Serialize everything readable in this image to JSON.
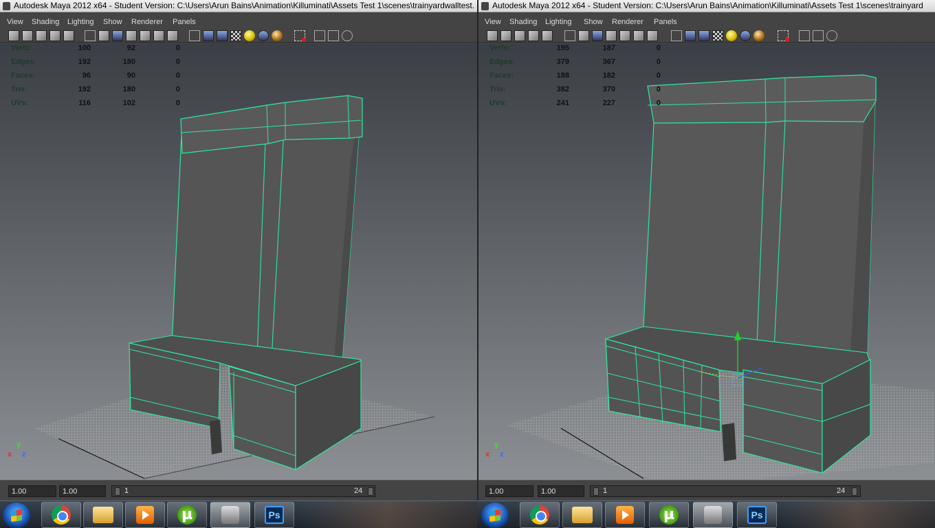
{
  "left": {
    "window_title": "Autodesk Maya 2012 x64 - Student Version: C:\\Users\\Arun Bains\\Animation\\Killuminati\\Assets Test 1\\scenes\\trainyardwalltest.",
    "menu": [
      "View",
      "Shading",
      "Lighting",
      "Show",
      "Renderer",
      "Panels"
    ],
    "stats": [
      {
        "label": "Verts:",
        "a": "100",
        "b": "92",
        "c": "0"
      },
      {
        "label": "Edges:",
        "a": "192",
        "b": "180",
        "c": "0"
      },
      {
        "label": "Faces:",
        "a": "96",
        "b": "90",
        "c": "0"
      },
      {
        "label": "Tris:",
        "a": "192",
        "b": "180",
        "c": "0"
      },
      {
        "label": "UVs:",
        "a": "116",
        "b": "102",
        "c": "0"
      }
    ],
    "axis": {
      "x": "x",
      "y": "y",
      "z": "z"
    },
    "time_start": "1.00",
    "time_end": "1.00",
    "frame_start": "1",
    "frame_end": "24"
  },
  "right": {
    "window_title": "Autodesk Maya 2012 x64 - Student Version: C:\\Users\\Arun Bains\\Animation\\Killuminati\\Assets Test 1\\scenes\\trainyard",
    "menu": [
      "View",
      "Shading",
      "Lighting",
      "Show",
      "Renderer",
      "Panels"
    ],
    "stats": [
      {
        "label": "Verts:",
        "a": "195",
        "b": "187",
        "c": "0"
      },
      {
        "label": "Edges:",
        "a": "379",
        "b": "367",
        "c": "0"
      },
      {
        "label": "Faces:",
        "a": "188",
        "b": "182",
        "c": "0"
      },
      {
        "label": "Tris:",
        "a": "382",
        "b": "370",
        "c": "0"
      },
      {
        "label": "UVs:",
        "a": "241",
        "b": "227",
        "c": "0"
      }
    ],
    "axis": {
      "x": "x",
      "y": "y",
      "z": "z"
    },
    "time_start": "1.00",
    "time_end": "1.00",
    "frame_start": "1",
    "frame_end": "24"
  },
  "taskbar": {
    "buttons": [
      "chrome-icon",
      "explorer-icon",
      "media-player-icon",
      "utorrent-icon",
      "maya-icon",
      "photoshop-icon"
    ],
    "photoshop_label": "Ps"
  },
  "colors": {
    "wireframe": "#2ee8a0",
    "mesh": "#505050",
    "grid": "#c8c8c8"
  }
}
